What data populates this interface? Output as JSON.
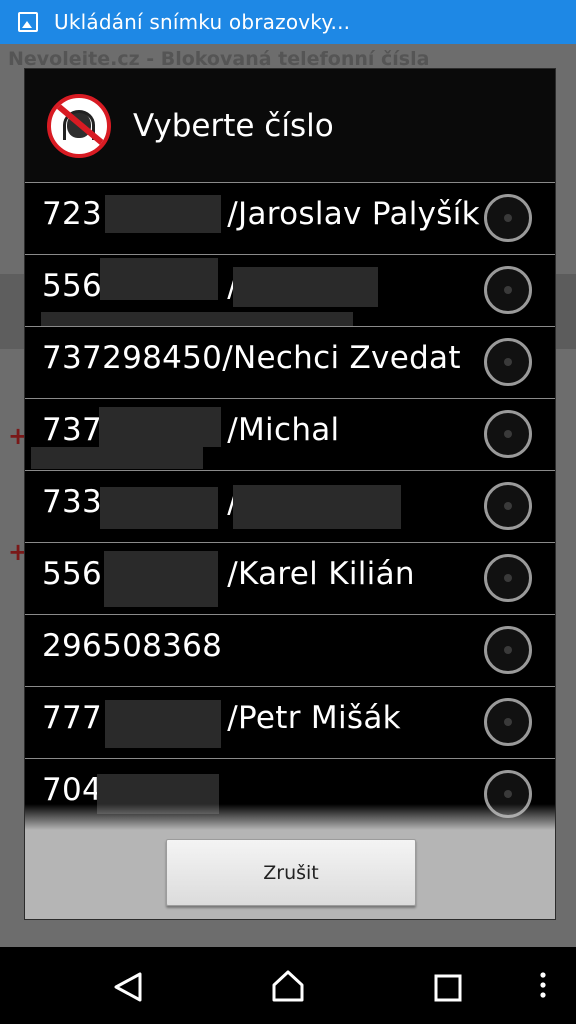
{
  "status_bar": {
    "text": "Ukládání snímku obrazovky..."
  },
  "background_app": {
    "title": "Nevoleite.cz - Blokovaná telefonní čísla",
    "plus_symbol": "+"
  },
  "dialog": {
    "title": "Vyberte číslo",
    "logo_icon": "no-calls-headset-icon",
    "items": [
      {
        "text": "723    /Jaroslav Palyšík"
      },
      {
        "text": "556    /"
      },
      {
        "text": "737298450/Nechci Zvedat"
      },
      {
        "text": "737    /Michal"
      },
      {
        "text": "733    /"
      },
      {
        "text": "556    /Karel Kilián"
      },
      {
        "text": "296508368"
      },
      {
        "text": "777    /Petr Mišák"
      },
      {
        "text": "704"
      }
    ],
    "cancel_label": "Zrušit"
  },
  "navbar": {
    "icons": [
      "back-icon",
      "home-icon",
      "recents-icon",
      "overflow-menu-icon"
    ]
  },
  "colors": {
    "status_bar": "#1e88e5",
    "logo_red": "#d81b23"
  }
}
